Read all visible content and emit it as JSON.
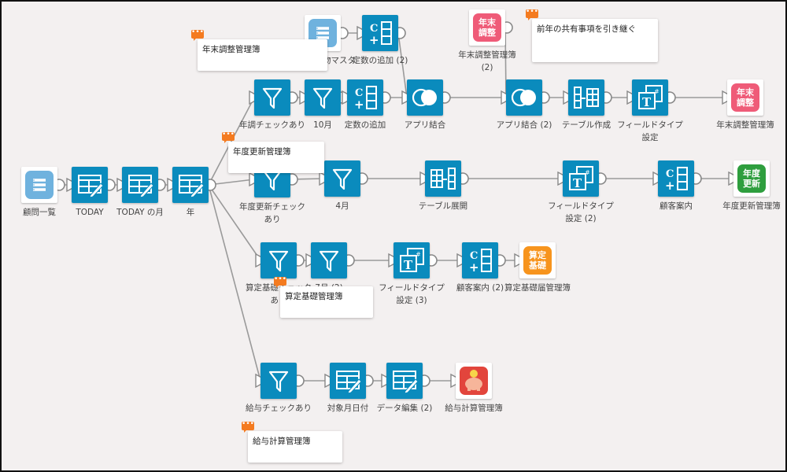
{
  "colors": {
    "node": "#0a8bbd",
    "canvas": "#f3f0f0",
    "comment_badge": "#f47b20",
    "edge": "#9a9a9a"
  },
  "nodes": [
    {
      "id": "n_komon",
      "label": "顧問一覧",
      "kind": "app",
      "app_color": "#6fb2de",
      "app_icon": "list-icon"
    },
    {
      "id": "n_today",
      "label": "TODAY",
      "kind": "edit"
    },
    {
      "id": "n_todaymonth",
      "label": "TODAY の月",
      "kind": "edit"
    },
    {
      "id": "n_year",
      "label": "年",
      "kind": "edit"
    },
    {
      "id": "n_nenchocheck",
      "label": "年調チェックあり",
      "kind": "filter"
    },
    {
      "id": "n_oct",
      "label": "10月",
      "kind": "filter"
    },
    {
      "id": "n_const",
      "label": "定数の追加",
      "kind": "const"
    },
    {
      "id": "n_join",
      "label": "アプリ結合",
      "kind": "join"
    },
    {
      "id": "n_master",
      "label": "年調納品物マスタ",
      "kind": "app",
      "app_color": "#6fb2de",
      "app_icon": "list-icon"
    },
    {
      "id": "n_const2",
      "label": "定数の追加 (2)",
      "kind": "const"
    },
    {
      "id": "n_nenmatsu2",
      "label": "年末調整管理簿 (2)",
      "kind": "app",
      "app_color": "#ef5b78",
      "app_text": "年末\n調整"
    },
    {
      "id": "n_join2",
      "label": "アプリ結合 (2)",
      "kind": "join"
    },
    {
      "id": "n_tablecreate",
      "label": "テーブル作成",
      "kind": "tablecreate"
    },
    {
      "id": "n_fieldtype",
      "label": "フィールドタイプ設定",
      "kind": "fieldtype"
    },
    {
      "id": "n_nenmatsu",
      "label": "年末調整管理簿",
      "kind": "app",
      "app_color": "#ef5b78",
      "app_text": "年末\n調整"
    },
    {
      "id": "n_nendocheck",
      "label": "年度更新チェックあり",
      "kind": "filter"
    },
    {
      "id": "n_apr",
      "label": "4月",
      "kind": "filter"
    },
    {
      "id": "n_tableexpand",
      "label": "テーブル展開",
      "kind": "tableexpand"
    },
    {
      "id": "n_fieldtype2",
      "label": "フィールドタイプ設定 (2)",
      "kind": "fieldtype"
    },
    {
      "id": "n_kokyaku",
      "label": "顧客案内",
      "kind": "const"
    },
    {
      "id": "n_nendo",
      "label": "年度更新管理簿",
      "kind": "app",
      "app_color": "#2e9e3e",
      "app_text": "年度\n更新"
    },
    {
      "id": "n_santeicheck",
      "label": "算定基礎チェックあり",
      "kind": "filter"
    },
    {
      "id": "n_jul",
      "label": "7月 (2)",
      "kind": "filter"
    },
    {
      "id": "n_fieldtype3",
      "label": "フィールドタイプ設定 (3)",
      "kind": "fieldtype"
    },
    {
      "id": "n_kokyaku2",
      "label": "顧客案内 (2)",
      "kind": "const"
    },
    {
      "id": "n_santei",
      "label": "算定基礎届管理簿",
      "kind": "app",
      "app_color": "#f7941d",
      "app_text": "算定\n基礎"
    },
    {
      "id": "n_kyuyocheck",
      "label": "給与チェックあり",
      "kind": "filter"
    },
    {
      "id": "n_taisho",
      "label": "対象月日付",
      "kind": "edit"
    },
    {
      "id": "n_dataedit2",
      "label": "データ編集 (2)",
      "kind": "edit"
    },
    {
      "id": "n_kyuyo",
      "label": "給与計算管理簿",
      "kind": "app",
      "app_color": "#e2453c",
      "app_icon": "piggy-bank-icon"
    }
  ],
  "edges": [
    [
      "n_komon",
      "n_today"
    ],
    [
      "n_today",
      "n_todaymonth"
    ],
    [
      "n_todaymonth",
      "n_year"
    ],
    [
      "n_year",
      "n_nenchocheck"
    ],
    [
      "n_year",
      "n_nendocheck"
    ],
    [
      "n_year",
      "n_santeicheck"
    ],
    [
      "n_year",
      "n_kyuyocheck"
    ],
    [
      "n_nenchocheck",
      "n_oct"
    ],
    [
      "n_oct",
      "n_const"
    ],
    [
      "n_const",
      "n_join"
    ],
    [
      "n_master",
      "n_const2"
    ],
    [
      "n_const2",
      "n_join"
    ],
    [
      "n_join",
      "n_join2"
    ],
    [
      "n_nenmatsu2",
      "n_join2"
    ],
    [
      "n_join2",
      "n_tablecreate"
    ],
    [
      "n_tablecreate",
      "n_fieldtype"
    ],
    [
      "n_fieldtype",
      "n_nenmatsu"
    ],
    [
      "n_nendocheck",
      "n_apr"
    ],
    [
      "n_apr",
      "n_tableexpand"
    ],
    [
      "n_tableexpand",
      "n_fieldtype2"
    ],
    [
      "n_fieldtype2",
      "n_kokyaku"
    ],
    [
      "n_kokyaku",
      "n_nendo"
    ],
    [
      "n_santeicheck",
      "n_jul"
    ],
    [
      "n_jul",
      "n_fieldtype3"
    ],
    [
      "n_fieldtype3",
      "n_kokyaku2"
    ],
    [
      "n_kokyaku2",
      "n_santei"
    ],
    [
      "n_kyuyocheck",
      "n_taisho"
    ],
    [
      "n_taisho",
      "n_dataedit2"
    ],
    [
      "n_dataedit2",
      "n_kyuyo"
    ]
  ],
  "comments": [
    {
      "text": "年末調整管理簿"
    },
    {
      "text": "年度更新管理簿"
    },
    {
      "text": "算定基礎管理簿"
    },
    {
      "text": "給与計算管理簿"
    },
    {
      "text": "前年の共有事項を引き継ぐ"
    }
  ]
}
